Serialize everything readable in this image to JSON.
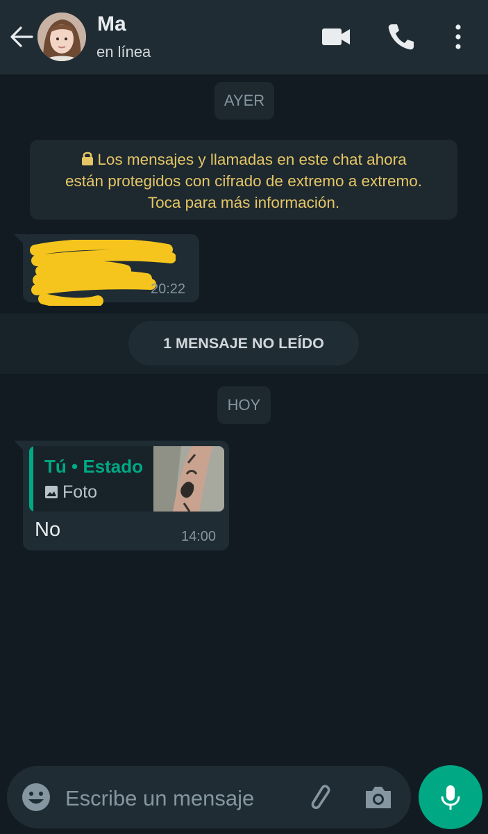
{
  "header": {
    "contact_name": "Ma",
    "status": "en línea"
  },
  "chat": {
    "date_yesterday": "AYER",
    "encryption_notice": {
      "line1": "Los mensajes y llamadas en este chat ahora",
      "line2": "están protegidos con cifrado de extremo a extremo.",
      "line3": "Toca para más información."
    },
    "message1": {
      "time": "20:22",
      "text_redacted": true
    },
    "unread_banner": "1 MENSAJE NO LEÍDO",
    "date_today": "HOY",
    "message2": {
      "quote_title": "Tú • Estado",
      "quote_type": "Foto",
      "text": "No",
      "time": "14:00"
    }
  },
  "composer": {
    "placeholder": "Escribe un mensaje"
  },
  "colors": {
    "header_bg": "#1f2c34",
    "chat_bg": "#121b22",
    "bubble_bg": "#1f2c34",
    "accent": "#00a884",
    "notice_text": "#e5c665",
    "redaction": "#f6c51d"
  }
}
